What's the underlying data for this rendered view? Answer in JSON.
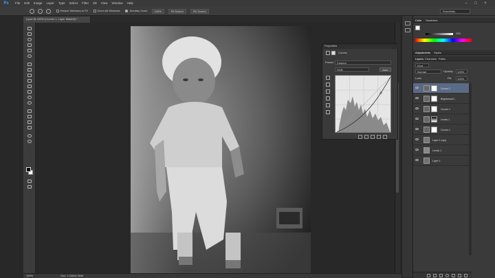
{
  "app": {
    "logo": "Ps",
    "menu": [
      "File",
      "Edit",
      "Image",
      "Layer",
      "Type",
      "Select",
      "Filter",
      "3D",
      "View",
      "Window",
      "Help"
    ],
    "window_controls": [
      "–",
      "□",
      "×"
    ]
  },
  "options_bar": {
    "resize_windows": "Resize Windows to Fit",
    "zoom_all": "Zoom All Windows",
    "scrubby_zoom": "Scrubby Zoom",
    "btn_100": "100%",
    "btn_fit": "Fit Screen",
    "btn_fill": "Fill Screen",
    "workspace": "Essentials"
  },
  "document_tab": {
    "label": "Lynol @ 100% (Curves 1, Layer Mask/8) *"
  },
  "properties": {
    "tab": "Properties",
    "type_label": "Curves",
    "preset_label": "Preset:",
    "preset_value": "Custom",
    "channel_value": "RGB",
    "auto_label": "Auto"
  },
  "color_panel": {
    "tab_color": "Color",
    "tab_swatches": "Swatches",
    "value": "255"
  },
  "adjustments": {
    "tab_adjust": "Adjustments",
    "tab_styles": "Styles"
  },
  "layers_panel": {
    "tab_layers": "Layers",
    "tab_channels": "Channels",
    "tab_paths": "Paths",
    "kind": "Kind",
    "blend_mode": "Normal",
    "opacity_label": "Opacity:",
    "opacity_value": "100%",
    "lock_label": "Lock:",
    "fill_label": "Fill:",
    "fill_value": "100%",
    "layers": [
      {
        "name": "Curves 2",
        "selected": true
      },
      {
        "name": "Brightness/C...",
        "selected": false
      },
      {
        "name": "Curves 1",
        "selected": false
      },
      {
        "name": "Levels 1",
        "selected": false
      },
      {
        "name": "Curves 1",
        "selected": false
      },
      {
        "name": "Layer 1 copy",
        "selected": false
      },
      {
        "name": "Levels 1",
        "selected": false
      },
      {
        "name": "Layer 1",
        "selected": false
      }
    ]
  },
  "status": {
    "zoom": "100%",
    "doc": "Doc: 1.24M/1.36M"
  },
  "colors": {
    "accent": "#5b6a86",
    "panel": "#3a3a3a",
    "bg": "#282828"
  }
}
